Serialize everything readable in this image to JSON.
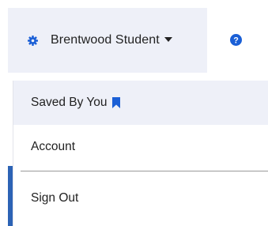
{
  "header": {
    "user_name": "Brentwood Student",
    "icons": {
      "settings": "gear-icon",
      "caret": "caret-down-icon",
      "help": "question-circle-icon"
    }
  },
  "menu": {
    "items": [
      {
        "label": "Saved By You",
        "icon": "bookmark-icon",
        "highlighted": true
      },
      {
        "label": "Account"
      },
      {
        "label": "Sign Out"
      }
    ]
  },
  "colors": {
    "accent": "#1a5fd6",
    "highlight_bg": "#eef0f8",
    "divider": "#9a9a9a"
  }
}
